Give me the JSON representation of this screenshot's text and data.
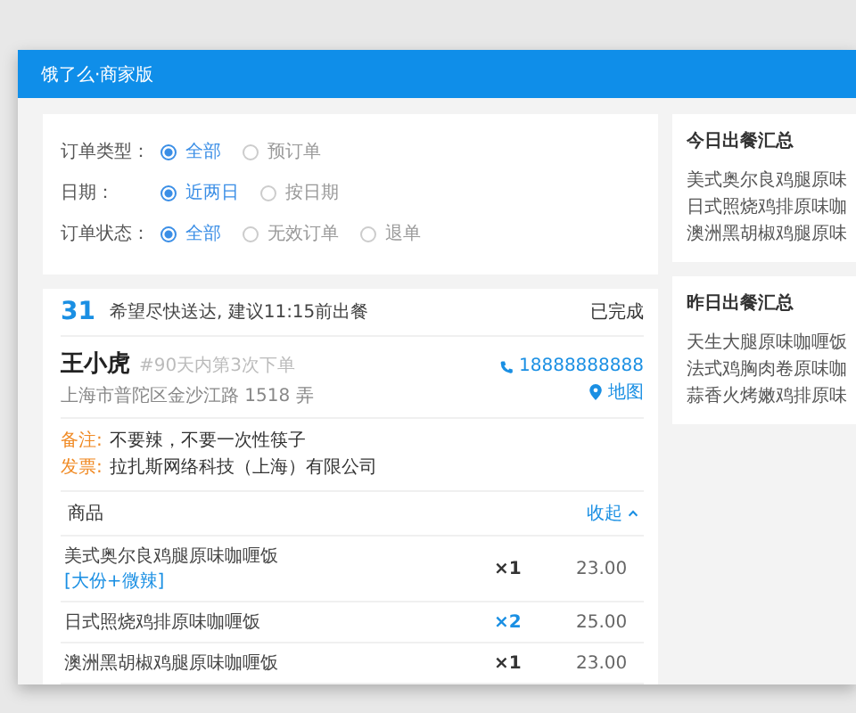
{
  "window": {
    "title": "饿了么·商家版"
  },
  "filters": [
    {
      "label": "订单类型：",
      "options": [
        {
          "label": "全部",
          "selected": true
        },
        {
          "label": "预订单",
          "selected": false
        }
      ]
    },
    {
      "label": "日期：",
      "options": [
        {
          "label": "近两日",
          "selected": true
        },
        {
          "label": "按日期",
          "selected": false
        }
      ]
    },
    {
      "label": "订单状态：",
      "options": [
        {
          "label": "全部",
          "selected": true
        },
        {
          "label": "无效订单",
          "selected": false
        },
        {
          "label": "退单",
          "selected": false
        }
      ]
    }
  ],
  "order": {
    "number": "31",
    "note": "希望尽快送达, 建议11:15前出餐",
    "status": "已完成",
    "customer": {
      "name": "王小虎",
      "tag": "#90天内第3次下单",
      "address": "上海市普陀区金沙江路 1518 弄",
      "phone": "18888888888",
      "map_link": "地图"
    },
    "remarks": [
      {
        "label": "备注:",
        "value": "不要辣，不要一次性筷子"
      },
      {
        "label": "发票:",
        "value": "拉扎斯网络科技（上海）有限公司"
      }
    ],
    "goods": {
      "title": "商品",
      "toggle": "收起",
      "items": [
        {
          "name": "美式奥尔良鸡腿原味咖喱饭",
          "spec": "[大份+微辣]",
          "qty": "×1",
          "emphasized": false,
          "price": "23.00"
        },
        {
          "name": "日式照烧鸡排原味咖喱饭",
          "qty": "×2",
          "emphasized": true,
          "price": "25.00"
        },
        {
          "name": "澳洲黑胡椒鸡腿原味咖喱饭",
          "qty": "×1",
          "emphasized": false,
          "price": "23.00"
        }
      ]
    }
  },
  "summaries": [
    {
      "title": "今日出餐汇总",
      "items": [
        "美式奥尔良鸡腿原味",
        "日式照烧鸡排原味咖",
        "澳洲黑胡椒鸡腿原味"
      ]
    },
    {
      "title": "昨日出餐汇总",
      "items": [
        "天生大腿原味咖喱饭",
        "法式鸡胸肉卷原味咖",
        "蒜香火烤嫩鸡排原味"
      ]
    }
  ]
}
